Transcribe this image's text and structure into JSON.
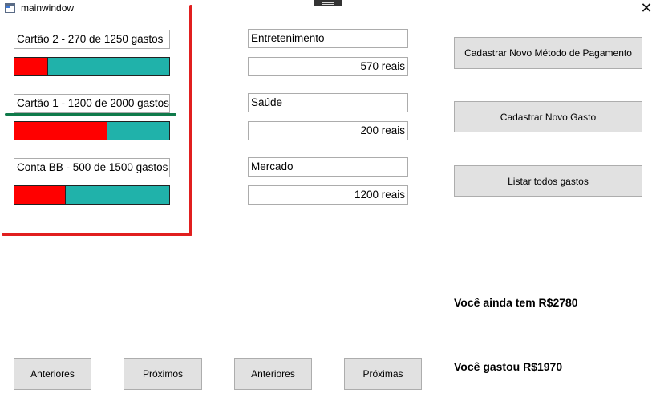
{
  "window": {
    "title": "mainwindow",
    "close_glyph": "✕"
  },
  "payment_methods": [
    {
      "label": "Cartão 2 - 270 de 1250 gastos",
      "spent": 270,
      "limit": 1250
    },
    {
      "label": "Cartão 1 - 1200 de 2000 gastos",
      "spent": 1200,
      "limit": 2000
    },
    {
      "label": "Conta BB - 500 de 1500 gastos",
      "spent": 500,
      "limit": 1500
    }
  ],
  "categories": [
    {
      "name": "Entretenimento",
      "amount": "570 reais"
    },
    {
      "name": "Saúde",
      "amount": "200 reais"
    },
    {
      "name": "Mercado",
      "amount": "1200 reais"
    }
  ],
  "actions": {
    "new_payment_method": "Cadastrar Novo Método de Pagamento",
    "new_expense": "Cadastrar Novo Gasto",
    "list_expenses": "Listar todos gastos"
  },
  "pagination": {
    "methods_prev": "Anteriores",
    "methods_next": "Próximos",
    "categories_prev": "Anteriores",
    "categories_next": "Próximas"
  },
  "summary": {
    "remaining": "Você ainda tem R$2780",
    "spent": "Você gastou R$1970"
  },
  "colors": {
    "bar_spent": "#ff0000",
    "bar_remaining": "#20b2aa",
    "annotation_red": "#e11f1f",
    "annotation_green": "#0f7a4a"
  },
  "icons": {
    "app": "window-icon",
    "close": "close-icon"
  }
}
